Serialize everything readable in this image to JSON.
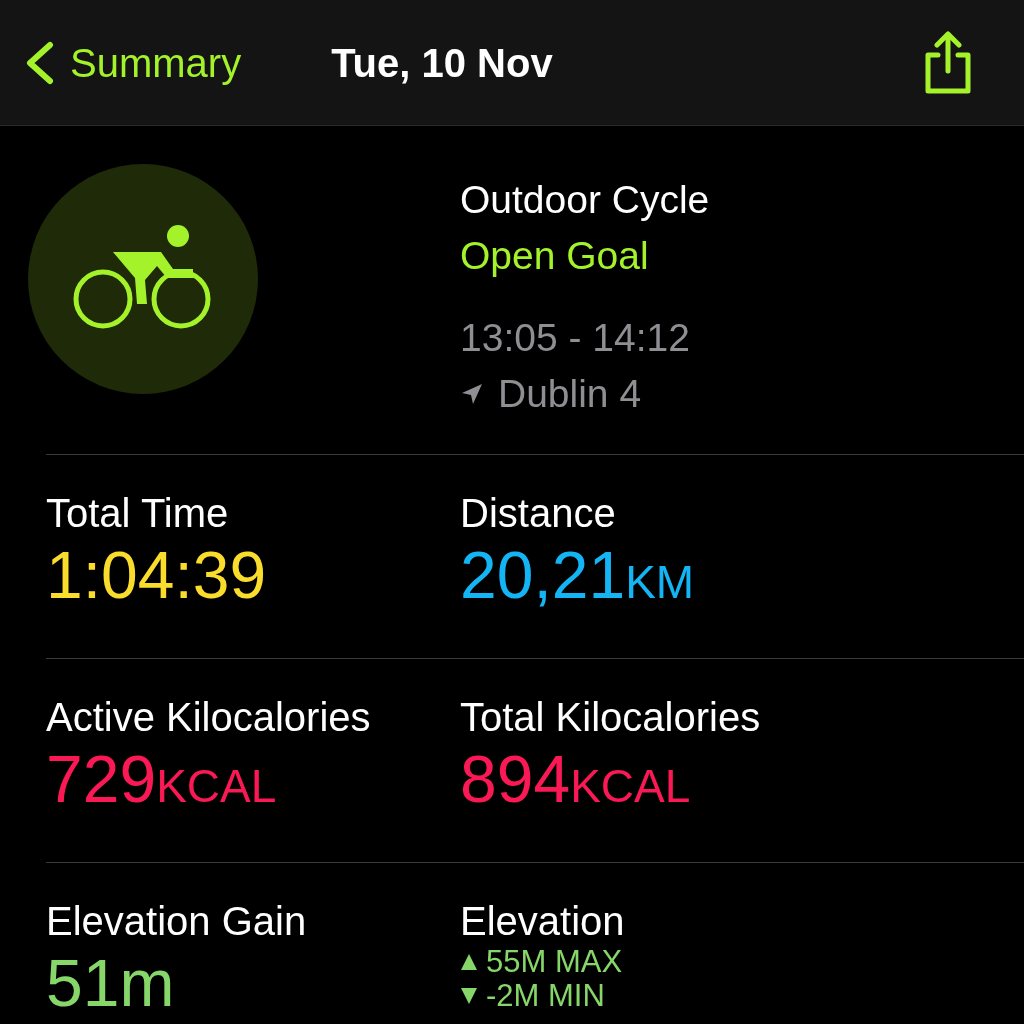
{
  "nav": {
    "back_label": "Summary",
    "title": "Tue, 10 Nov"
  },
  "workout": {
    "name": "Outdoor Cycle",
    "goal": "Open Goal",
    "time": "13:05 - 14:12",
    "location": "Dublin 4"
  },
  "metrics": [
    {
      "kind": "value",
      "label": "Total Time",
      "value": "1:04:39",
      "color": "#fadc2c"
    },
    {
      "kind": "value",
      "label": "Distance",
      "value": "20,21",
      "unit": "KM",
      "color": "#13b5f5"
    },
    {
      "kind": "value",
      "label": "Active Kilocalories",
      "value": "729",
      "unit": "KCAL",
      "color": "#fa1955"
    },
    {
      "kind": "value",
      "label": "Total Kilocalories",
      "value": "894",
      "unit": "KCAL",
      "color": "#fa1955"
    },
    {
      "kind": "value",
      "label": "Elevation Gain",
      "value": "51m",
      "color": "#86d66a"
    },
    {
      "kind": "range",
      "label": "Elevation",
      "max": "55M MAX",
      "min": "-2M MIN",
      "color": "#86d66a"
    }
  ]
}
